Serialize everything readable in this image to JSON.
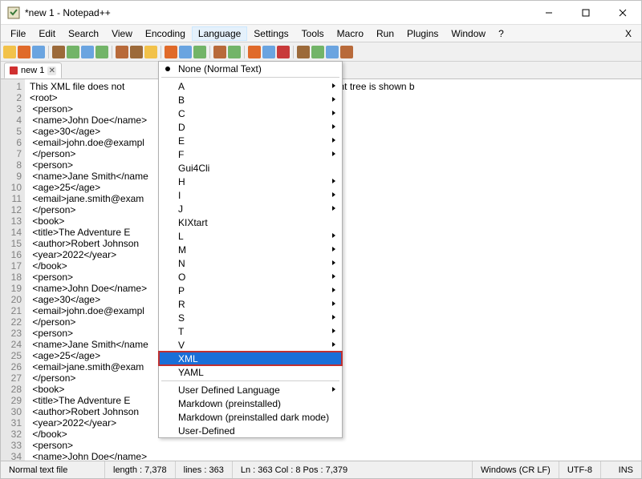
{
  "titlebar": {
    "title": "*new 1 - Notepad++"
  },
  "menubar": {
    "items": [
      "File",
      "Edit",
      "Search",
      "View",
      "Encoding",
      "Language",
      "Settings",
      "Tools",
      "Macro",
      "Run",
      "Plugins",
      "Window",
      "?"
    ]
  },
  "tab": {
    "label": "new 1"
  },
  "editor": {
    "lines": [
      "This XML file does not                         ion associated with it. The document tree is shown b",
      "<root>",
      " <person>",
      " <name>John Doe</name>",
      " <age>30</age>",
      " <email>john.doe@exampl",
      " </person>",
      " <person>",
      " <name>Jane Smith</name",
      " <age>25</age>",
      " <email>jane.smith@exam",
      " </person>",
      " <book>",
      " <title>The Adventure E",
      " <author>Robert Johnson",
      " <year>2022</year>",
      " </book>",
      " <person>",
      " <name>John Doe</name>",
      " <age>30</age>",
      " <email>john.doe@exampl",
      " </person>",
      " <person>",
      " <name>Jane Smith</name",
      " <age>25</age>",
      " <email>jane.smith@exam",
      " </person>",
      " <book>",
      " <title>The Adventure E",
      " <author>Robert Johnson",
      " <year>2022</year>",
      " </book>",
      " <person>",
      " <name>John Doe</name>",
      " <age>30</age>"
    ]
  },
  "dropdown": {
    "top": {
      "label": "None (Normal Text)"
    },
    "letters": [
      "A",
      "B",
      "C",
      "D",
      "E",
      "F",
      "Gui4Cli",
      "H",
      "I",
      "J",
      "KIXtart",
      "L",
      "M",
      "N",
      "O",
      "P",
      "R",
      "S",
      "T",
      "V",
      "XML",
      "YAML"
    ],
    "selected": "XML",
    "letter_has_sub": {
      "A": true,
      "B": true,
      "C": true,
      "D": true,
      "E": true,
      "F": true,
      "H": true,
      "I": true,
      "J": true,
      "L": true,
      "M": true,
      "N": true,
      "O": true,
      "P": true,
      "R": true,
      "S": true,
      "T": true,
      "V": true
    },
    "bottom": [
      {
        "label": "User Defined Language",
        "sub": true
      },
      {
        "label": "Markdown (preinstalled)",
        "sub": false
      },
      {
        "label": "Markdown (preinstalled dark mode)",
        "sub": false
      },
      {
        "label": "User-Defined",
        "sub": false
      }
    ]
  },
  "status": {
    "filetype": "Normal text file",
    "length": "length : 7,378",
    "lines": "lines : 363",
    "pos": "Ln : 363   Col : 8   Pos : 7,379",
    "eol": "Windows (CR LF)",
    "encoding": "UTF-8",
    "ins": "INS"
  },
  "toolbar_colors": [
    "#f2c24a",
    "#e06a2a",
    "#6aa4e0",
    "#9c6a3a",
    "#72b468",
    "#6aa4e0",
    "#72b468",
    "#b86a3a",
    "#9c6a3a",
    "#f2c24a",
    "#e06a2a",
    "#6aa4e0",
    "#72b468",
    "#b86a3a",
    "#72b468",
    "#e06a2a",
    "#6aa4e0",
    "#c83a3a",
    "#9c6a3a",
    "#72b468",
    "#6aa4e0",
    "#b86a3a"
  ]
}
